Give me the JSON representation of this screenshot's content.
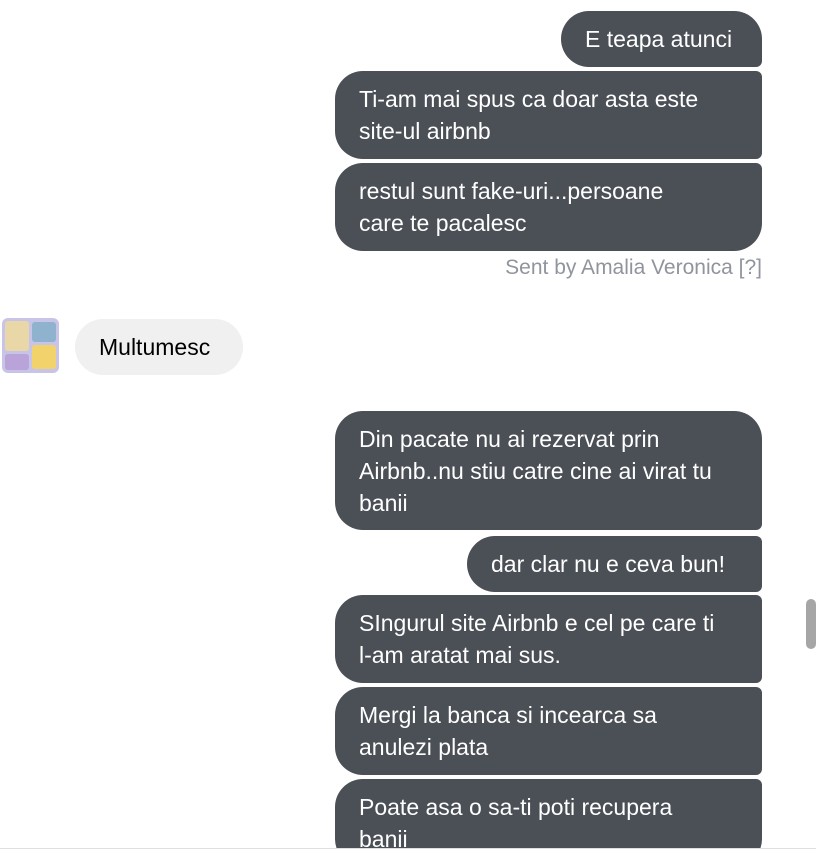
{
  "messages_group1": [
    {
      "text": "E teapa atunci"
    },
    {
      "text": "Ti-am mai spus ca doar asta este\nsite-ul airbnb"
    },
    {
      "text": "restul sunt fake-uri...persoane\ncare te pacalesc"
    }
  ],
  "sent_by": "Sent by Amalia Veronica [?]",
  "incoming_message": "Multumesc",
  "messages_group2": [
    {
      "text": "Din pacate nu ai rezervat prin\nAirbnb..nu stiu catre cine ai virat tu\nbanii"
    },
    {
      "text": "dar clar nu e ceva bun!"
    },
    {
      "text": "SIngurul site Airbnb e cel pe care ti\nl-am aratat mai sus."
    },
    {
      "text": "Mergi la banca si incearca sa\nanulezi plata"
    },
    {
      "text": "Poate asa o sa-ti poti recupera\nbanii"
    }
  ],
  "colors": {
    "outgoing_bubble": "#4b4f56",
    "incoming_bubble": "#f1f0f0",
    "meta_text": "#90949c"
  },
  "icons": [
    "contact-avatar"
  ]
}
